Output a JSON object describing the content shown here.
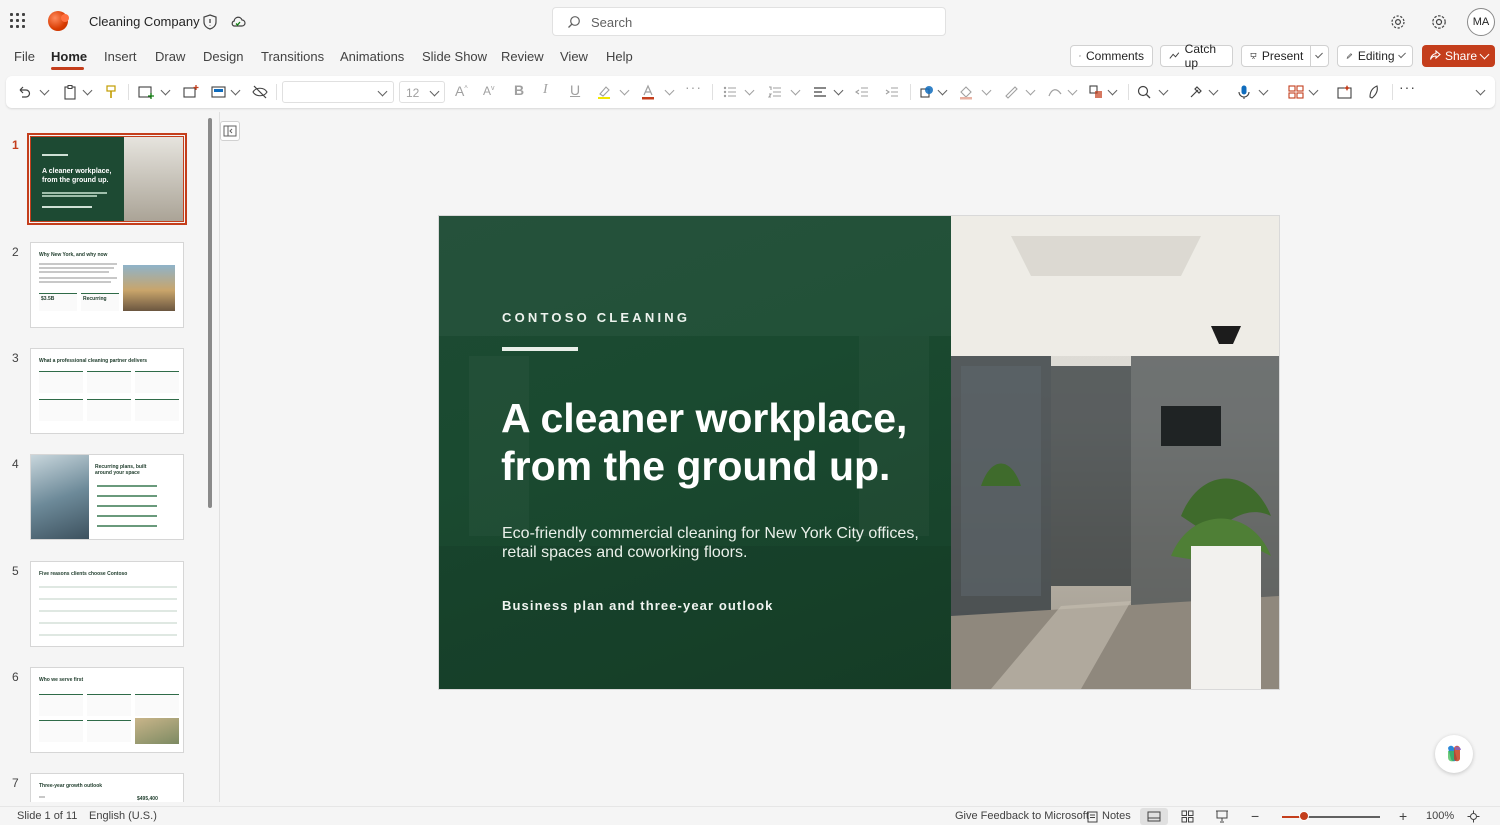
{
  "app": {
    "title": "Cleaning Company",
    "search_placeholder": "Search",
    "avatar_initials": "MA",
    "accent_color": "#c43e1c",
    "brand_color": "#1d4a33"
  },
  "menu": {
    "items": [
      "File",
      "Home",
      "Insert",
      "Draw",
      "Design",
      "Transitions",
      "Animations",
      "Slide Show",
      "Review",
      "View",
      "Help"
    ],
    "active": "Home"
  },
  "header_buttons": {
    "comments": "Comments",
    "catch_up": "Catch up",
    "present": "Present",
    "editing": "Editing",
    "share": "Share"
  },
  "ribbon": {
    "font_name": "",
    "font_size": "12"
  },
  "thumbnails": [
    {
      "number": "1",
      "title": "A cleaner workplace, from the ground up.",
      "selected": true
    },
    {
      "number": "2",
      "title": "Why New York, and why now",
      "stats": [
        "$3.5B",
        "Recurring"
      ]
    },
    {
      "number": "3",
      "title": "What a professional cleaning partner delivers"
    },
    {
      "number": "4",
      "title": "Recurring plans, built around your space"
    },
    {
      "number": "5",
      "title": "Five reasons clients choose Contoso"
    },
    {
      "number": "6",
      "title": "Who we serve first"
    },
    {
      "number": "7",
      "title": "Three-year growth outlook",
      "stats": [
        "$495,400"
      ]
    }
  ],
  "slide": {
    "kicker": "CONTOSO CLEANING",
    "headline_line1": "A cleaner workplace,",
    "headline_line2": "from the ground up.",
    "subtitle": "Eco-friendly commercial cleaning for New York City offices, retail spaces and coworking floors.",
    "tagline": "Business plan and three-year outlook"
  },
  "status": {
    "slide_counter": "Slide 1 of 11",
    "language": "English (U.S.)",
    "feedback": "Give Feedback to Microsoft",
    "notes": "Notes",
    "zoom": "100%",
    "zoom_level": 0.22
  }
}
